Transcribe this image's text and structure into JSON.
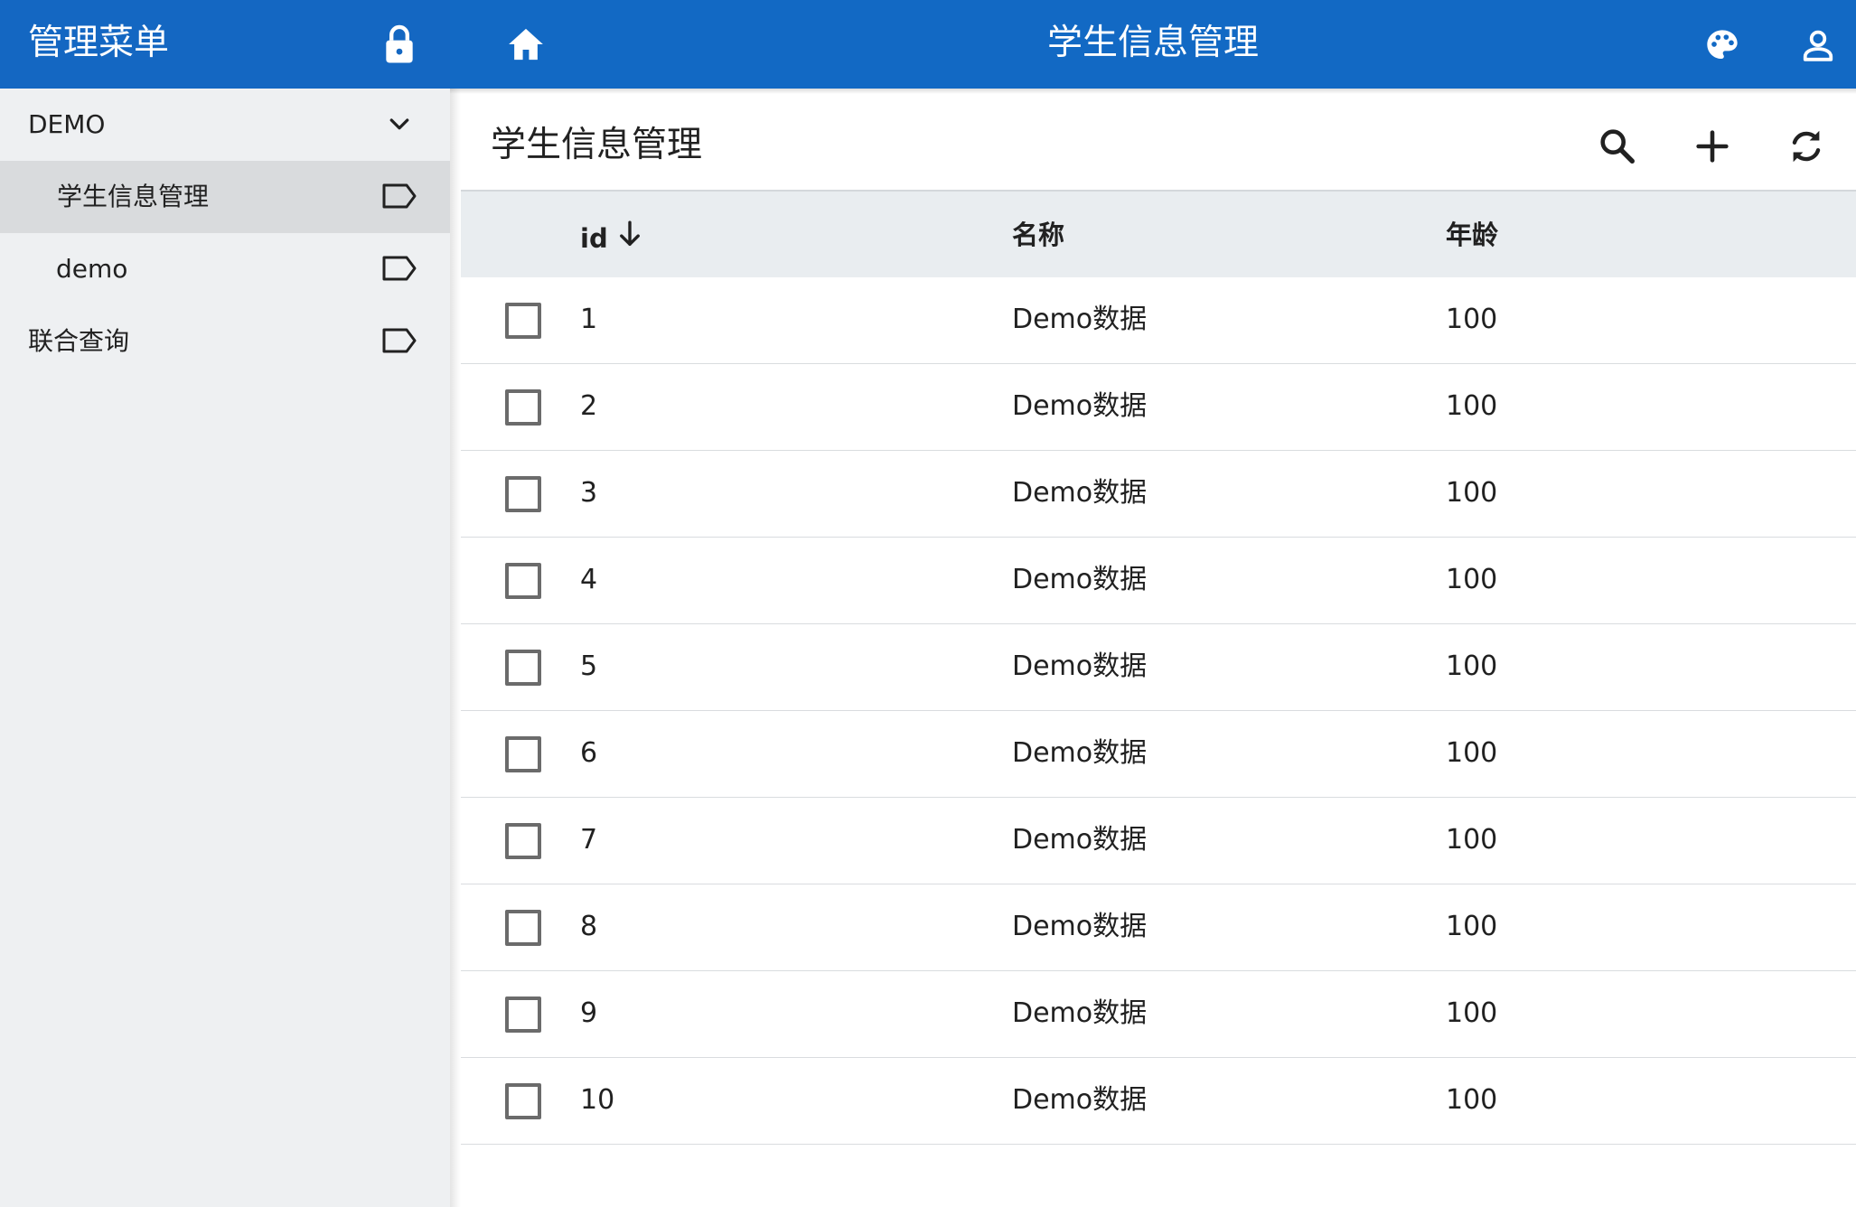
{
  "sidebar": {
    "title": "管理菜单",
    "group": {
      "label": "DEMO"
    },
    "items": [
      {
        "label": "学生信息管理",
        "selected": true
      },
      {
        "label": "demo",
        "selected": false
      },
      {
        "label": "联合查询",
        "selected": false
      }
    ]
  },
  "appbar": {
    "title": "学生信息管理"
  },
  "panel": {
    "title": "学生信息管理"
  },
  "table": {
    "columns": {
      "id": "id",
      "name": "名称",
      "age": "年龄"
    },
    "sort": {
      "column": "id",
      "direction": "descending-arrow"
    },
    "rows": [
      {
        "id": "1",
        "name": "Demo数据",
        "age": "100"
      },
      {
        "id": "2",
        "name": "Demo数据",
        "age": "100"
      },
      {
        "id": "3",
        "name": "Demo数据",
        "age": "100"
      },
      {
        "id": "4",
        "name": "Demo数据",
        "age": "100"
      },
      {
        "id": "5",
        "name": "Demo数据",
        "age": "100"
      },
      {
        "id": "6",
        "name": "Demo数据",
        "age": "100"
      },
      {
        "id": "7",
        "name": "Demo数据",
        "age": "100"
      },
      {
        "id": "8",
        "name": "Demo数据",
        "age": "100"
      },
      {
        "id": "9",
        "name": "Demo数据",
        "age": "100"
      },
      {
        "id": "10",
        "name": "Demo数据",
        "age": "100"
      }
    ]
  },
  "icons": {
    "sidebar_header": "lock-icon",
    "group_toggle": "chevron-down-icon",
    "menu_item": "label-tag-icon",
    "appbar_left": "home-icon",
    "appbar_right": [
      "palette-icon",
      "account-icon"
    ],
    "toolbar": [
      "search-icon",
      "add-icon",
      "refresh-icon"
    ],
    "sort": "arrow-down-icon"
  },
  "colors": {
    "primary": "#1269c4",
    "sidebar_background": "#eef0f2",
    "selected_item": "#d9dbdd",
    "table_header": "#e9edf0"
  }
}
